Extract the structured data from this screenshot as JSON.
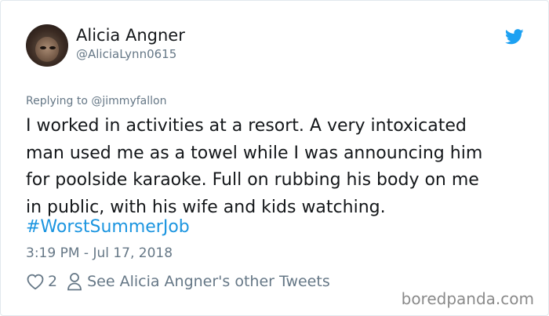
{
  "user": {
    "display_name": "Alicia Angner",
    "handle": "@AliciaLynn0615"
  },
  "tweet": {
    "reply_prefix": "Replying to ",
    "reply_mention": "@jimmyfallon",
    "text": "I worked in activities at a resort. A very intoxicated\nman used me as a towel while I was announcing him\nfor poolside karaoke. Full on rubbing his body on me\nin public, with his wife and kids watching.",
    "hashtag": "#WorstSummerJob",
    "timestamp": "3:19 PM - Jul 17, 2018"
  },
  "footer": {
    "like_count": "2",
    "other_tweets_label": "See Alicia Angner's other Tweets"
  },
  "watermark": "boredpanda.com",
  "icons": {
    "bird": "twitter-bird-icon",
    "heart": "heart-icon",
    "person": "person-icon"
  },
  "colors": {
    "brand_blue": "#1da1f2",
    "link_blue": "#1b95e0",
    "secondary_gray": "#657786",
    "text": "#14171a"
  }
}
